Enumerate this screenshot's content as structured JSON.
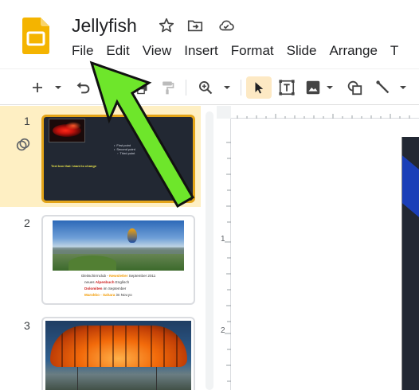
{
  "header": {
    "title": "Jellyfish",
    "icons": [
      "star-icon",
      "move-to-folder-icon",
      "cloud-saved-icon"
    ]
  },
  "menu": {
    "items": [
      "File",
      "Edit",
      "View",
      "Insert",
      "Format",
      "Slide",
      "Arrange",
      "T"
    ]
  },
  "toolbar": {
    "buttons": [
      "new-slide",
      "new-slide-dropdown",
      "undo",
      "print",
      "paint-format",
      "zoom",
      "zoom-dropdown",
      "select",
      "text-box",
      "image",
      "image-dropdown",
      "shape",
      "line",
      "line-dropdown"
    ]
  },
  "slides": [
    {
      "number": "1",
      "selected": true,
      "bullets": [
        "First point",
        "Second point",
        "Third point"
      ],
      "caption": "Text box that I want to change"
    },
    {
      "number": "2",
      "selected": false,
      "line1_prefix": "Gleitschirmclub - ",
      "line1_highlight": "Newsletter",
      "line1_suffix": " September 2011",
      "line2_prefix": "neues ",
      "line2_highlight": "Alpenbuch",
      "line2_suffix": " Englisch",
      "line3_highlight": "Dolomiten",
      "line3_suffix": " im September",
      "line4_highlight": "Marokko - Sahara",
      "line4_suffix": " im Nov.yo"
    },
    {
      "number": "3",
      "selected": false
    }
  ],
  "ruler": {
    "labels": [
      "1",
      "2"
    ]
  },
  "colors": {
    "selected_slide_bg": "#feefc3",
    "selected_border": "#e3a418",
    "annotation_arrow": "#6ee62b",
    "logo_yellow": "#f4b400"
  }
}
